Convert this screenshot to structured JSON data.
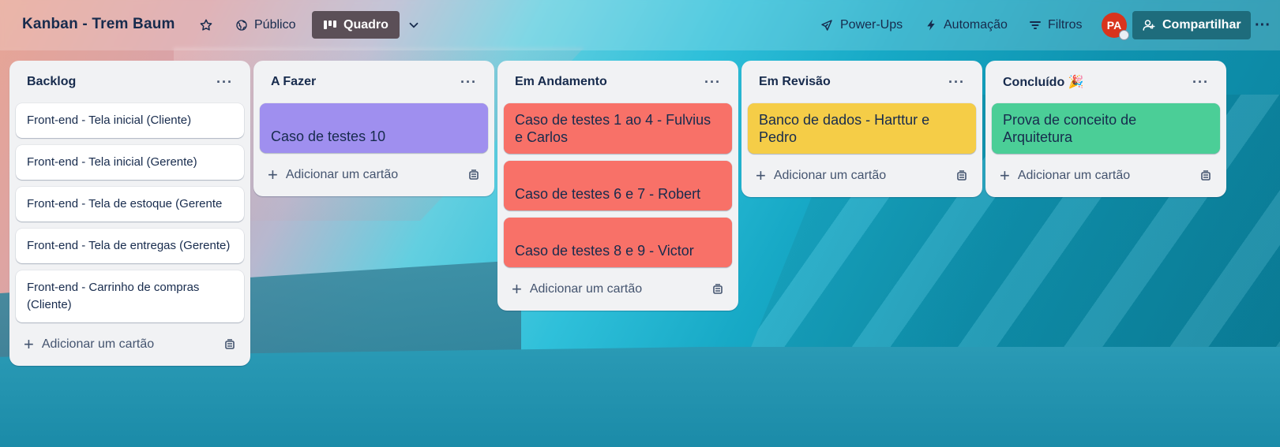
{
  "header": {
    "board_title": "Kanban - Trem Baum",
    "visibility_label": "Público",
    "view_label": "Quadro",
    "powerups_label": "Power-Ups",
    "automation_label": "Automação",
    "filters_label": "Filtros",
    "avatar_initials": "PA",
    "share_label": "Compartilhar",
    "more_label": "···"
  },
  "lists": [
    {
      "title": "Backlog",
      "menu": "···",
      "cards": [
        "Front-end - Tela inicial (Cliente)",
        "Front-end - Tela inicial (Gerente)",
        "Front-end - Tela de estoque (Gerente",
        "Front-end - Tela de entregas (Gerente)",
        "Front-end - Carrinho de compras (Cliente)"
      ],
      "add_label": "Adicionar um cartão"
    },
    {
      "title": "A Fazer",
      "menu": "···",
      "cards": [
        "Caso de testes 10"
      ],
      "card_color": "#9f8fef",
      "add_label": "Adicionar um cartão"
    },
    {
      "title": "Em Andamento",
      "menu": "···",
      "cards": [
        "Caso de testes 1 ao 4 - Fulvius e Carlos",
        "Caso de testes 6 e 7 - Robert",
        "Caso de testes 8 e 9 - Victor"
      ],
      "card_color": "#f87168",
      "add_label": "Adicionar um cartão"
    },
    {
      "title": "Em Revisão",
      "menu": "···",
      "cards": [
        "Banco de dados - Harttur e Pedro"
      ],
      "card_color": "#f5cd47",
      "add_label": "Adicionar um cartão"
    },
    {
      "title": "Concluído 🎉",
      "menu": "···",
      "cards": [
        "Prova de conceito de Arquitetura"
      ],
      "card_color": "#4bce97",
      "add_label": "Adicionar um cartão"
    }
  ]
}
